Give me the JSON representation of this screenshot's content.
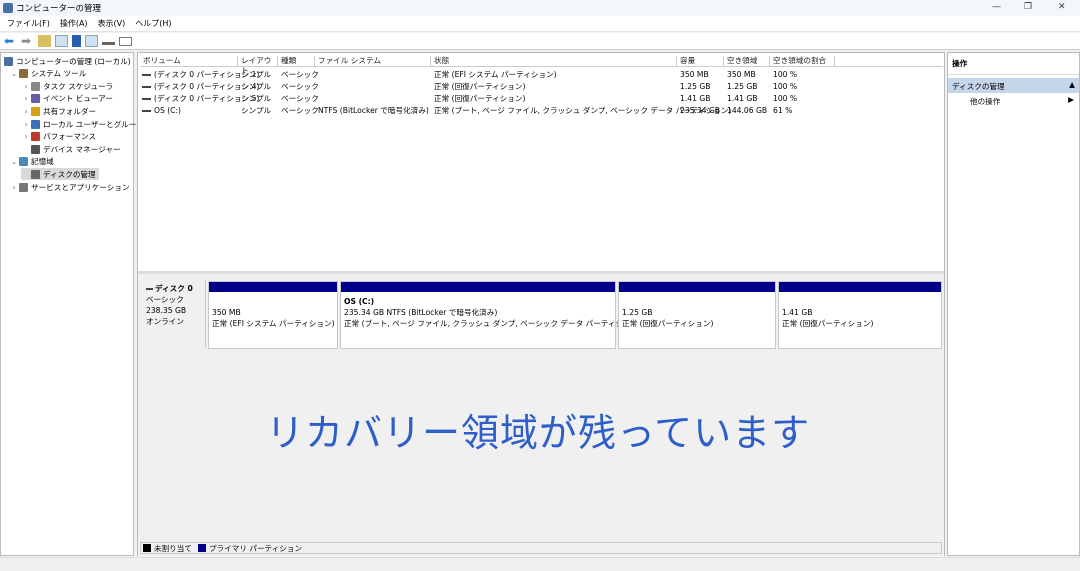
{
  "window": {
    "title": "コンピューターの管理",
    "controls": [
      "—",
      "❐",
      "✕"
    ]
  },
  "menu": [
    "ファイル(F)",
    "操作(A)",
    "表示(V)",
    "ヘルプ(H)"
  ],
  "toolbar": [
    "back-icon",
    "forward-icon",
    "up-folder-icon",
    "show-tree-icon",
    "help-icon",
    "properties-icon",
    "connect-icon",
    "view-icon"
  ],
  "tree": [
    {
      "label": "コンピューターの管理 (ローカル)",
      "level": 0,
      "expander": "",
      "color": "#4a6fa5"
    },
    {
      "label": "システム ツール",
      "level": 1,
      "expander": "⌄",
      "color": "#8a6d3b"
    },
    {
      "label": "タスク スケジューラ",
      "level": 2,
      "expander": "›",
      "color": "#888"
    },
    {
      "label": "イベント ビューアー",
      "level": 2,
      "expander": "›",
      "color": "#6b5ca5"
    },
    {
      "label": "共有フォルダー",
      "level": 2,
      "expander": "›",
      "color": "#d4a017"
    },
    {
      "label": "ローカル ユーザーとグループ",
      "level": 2,
      "expander": "›",
      "color": "#3b6fb6"
    },
    {
      "label": "パフォーマンス",
      "level": 2,
      "expander": "›",
      "color": "#c0392b"
    },
    {
      "label": "デバイス マネージャー",
      "level": 2,
      "expander": "",
      "color": "#555"
    },
    {
      "label": "記憶域",
      "level": 1,
      "expander": "⌄",
      "color": "#4a8ab5"
    },
    {
      "label": "ディスクの管理",
      "level": 2,
      "expander": "",
      "color": "#666",
      "selected": true
    },
    {
      "label": "サービスとアプリケーション",
      "level": 1,
      "expander": "›",
      "color": "#777"
    }
  ],
  "volumes": {
    "columns": [
      "ボリューム",
      "レイアウト",
      "種類",
      "ファイル システム",
      "状態",
      "容量",
      "空き領域",
      "空き領域の割合"
    ],
    "rows": [
      [
        "(ディスク 0 パーティション 1)",
        "シンプル",
        "ベーシック",
        "",
        "正常 (EFI システム パーティション)",
        "350 MB",
        "350 MB",
        "100 %"
      ],
      [
        "(ディスク 0 パーティション 4)",
        "シンプル",
        "ベーシック",
        "",
        "正常 (回復パーティション)",
        "1.25 GB",
        "1.25 GB",
        "100 %"
      ],
      [
        "(ディスク 0 パーティション 5)",
        "シンプル",
        "ベーシック",
        "",
        "正常 (回復パーティション)",
        "1.41 GB",
        "1.41 GB",
        "100 %"
      ],
      [
        "OS (C:)",
        "シンプル",
        "ベーシック",
        "NTFS (BitLocker で暗号化済み)",
        "正常 (ブート, ページ ファイル, クラッシュ ダンプ, ベーシック データ パーティション)",
        "235.34 GB",
        "144.06 GB",
        "61 %"
      ]
    ]
  },
  "disk": {
    "name": "ディスク 0",
    "type": "ベーシック",
    "size": "238.35 GB",
    "status": "オンライン",
    "partitions": [
      {
        "lines": [
          "",
          "350 MB",
          "正常 (EFI システム パーティション)"
        ]
      },
      {
        "lines": [
          "OS  (C:)",
          "235.34 GB NTFS (BitLocker で暗号化済み)",
          "正常 (ブート, ページ ファイル, クラッシュ ダンプ, ベーシック データ パーティション)"
        ]
      },
      {
        "lines": [
          "",
          "1.25 GB",
          "正常 (回復パーティション)"
        ]
      },
      {
        "lines": [
          "",
          "1.41 GB",
          "正常 (回復パーティション)"
        ]
      }
    ]
  },
  "overlay": "リカバリー領域が残っています",
  "legend": [
    {
      "label": "未割り当て",
      "color": "#000000"
    },
    {
      "label": "プライマリ パーティション",
      "color": "#00008b"
    }
  ],
  "actions": {
    "title": "操作",
    "section": "ディスクの管理",
    "item": "他の操作"
  },
  "colors": {
    "partition_bar": "#00008b",
    "overlay_text": "#2e5fc8",
    "action_section": "#c5d5ea"
  }
}
